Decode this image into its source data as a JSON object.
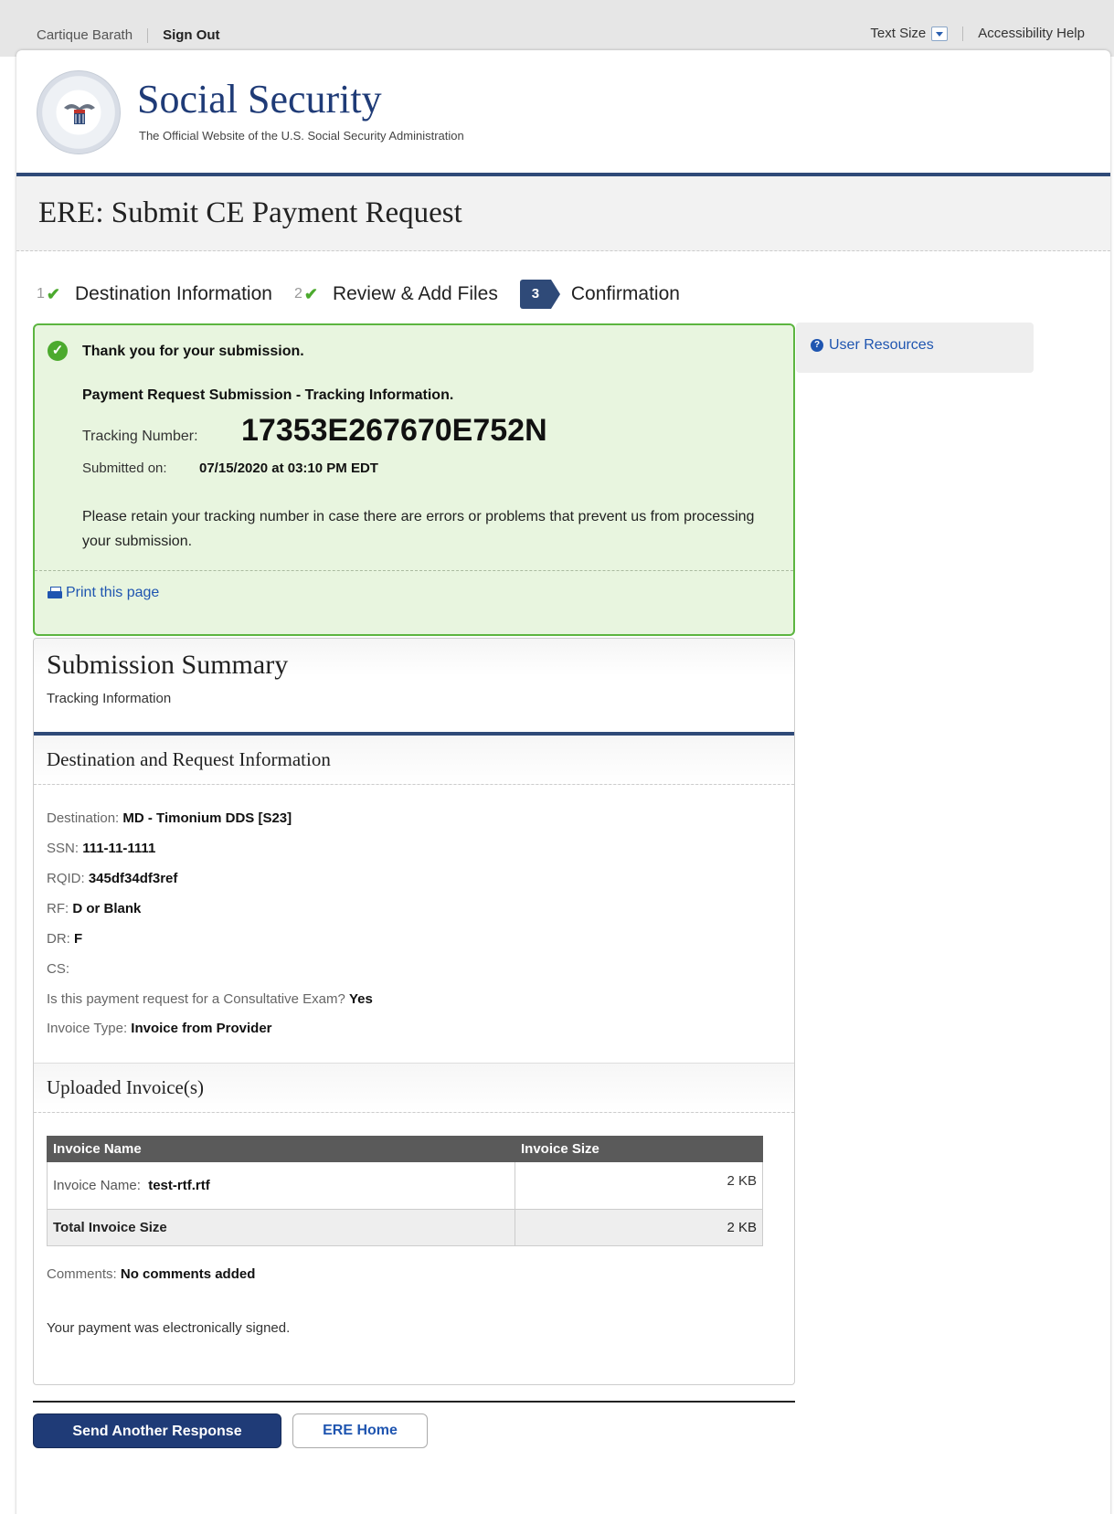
{
  "topbar": {
    "user_name": "Cartique Barath",
    "sign_out": "Sign Out",
    "text_size": "Text Size",
    "accessibility_help": "Accessibility Help"
  },
  "header": {
    "brand_title": "Social Security",
    "brand_subtitle": "The Official Website of the U.S. Social Security Administration"
  },
  "page": {
    "title": "ERE: Submit CE Payment Request"
  },
  "steps": [
    {
      "number": "1",
      "label": "Destination Information",
      "status": "done"
    },
    {
      "number": "2",
      "label": "Review & Add Files",
      "status": "done"
    },
    {
      "number": "3",
      "label": "Confirmation",
      "status": "active"
    }
  ],
  "confirmation": {
    "thanks": "Thank you for your submission.",
    "title": "Payment Request Submission - Tracking Information.",
    "tracking_label": "Tracking Number:",
    "tracking_number": "17353E267670E752N",
    "submitted_label": "Submitted on:",
    "submitted_value": "07/15/2020 at 03:10 PM EDT",
    "retain_message": "Please retain your tracking number in case there are errors or problems that prevent us from processing your submission.",
    "print_link": "Print this page"
  },
  "sidebar": {
    "user_resources": "User Resources"
  },
  "summary": {
    "title": "Submission Summary",
    "subtitle": "Tracking Information",
    "destination_section": "Destination and Request Information",
    "fields": [
      {
        "label": "Destination:",
        "value": "MD - Timonium DDS [S23]"
      },
      {
        "label": "SSN:",
        "value": "111-11-1111"
      },
      {
        "label": "RQID:",
        "value": "345df34df3ref"
      },
      {
        "label": "RF:",
        "value": "D or Blank"
      },
      {
        "label": "DR:",
        "value": "F"
      },
      {
        "label": "CS:",
        "value": ""
      },
      {
        "label": "Is this payment request for a Consultative Exam?",
        "value": "Yes"
      },
      {
        "label": "Invoice Type:",
        "value": "Invoice from Provider"
      }
    ],
    "invoices_section": "Uploaded Invoice(s)",
    "invoice_table": {
      "headers": [
        "Invoice Name",
        "Invoice Size"
      ],
      "rows": [
        {
          "name_label": "Invoice Name:",
          "name_value": "test-rtf.rtf",
          "size": "2 KB"
        }
      ],
      "total_label": "Total Invoice Size",
      "total_size": "2 KB"
    },
    "comments_label": "Comments:",
    "comments_value": "No comments added",
    "signed_message": "Your payment was electronically signed."
  },
  "actions": {
    "primary": "Send Another Response",
    "secondary": "ERE Home"
  },
  "colors": {
    "brand_navy": "#1f3b77",
    "success_green": "#5cb540",
    "success_bg": "#e8f5df",
    "link_blue": "#1f55b0"
  }
}
